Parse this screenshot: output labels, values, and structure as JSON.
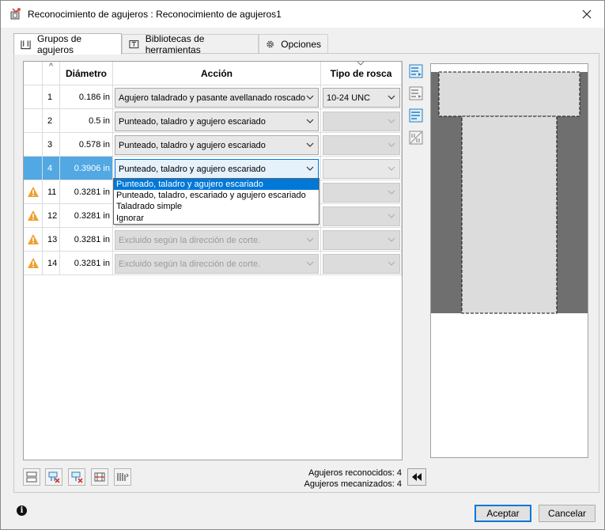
{
  "window": {
    "title": "Reconocimiento de agujeros : Reconocimiento de agujeros1"
  },
  "tabs": [
    {
      "label": "Grupos de agujeros",
      "icon": "hole-groups-icon"
    },
    {
      "label": "Bibliotecas de herramientas",
      "icon": "tool-library-icon"
    },
    {
      "label": "Opciones",
      "icon": "gear-icon"
    }
  ],
  "grid": {
    "headers": {
      "diameter": "Diámetro",
      "action": "Acción",
      "thread": "Tipo de rosca"
    },
    "rows": [
      {
        "num": "1",
        "diameter": "0.186 in",
        "action": "Agujero taladrado y pasante avellanado roscado",
        "thread": "10-24 UNC",
        "warning": false,
        "disabled": false
      },
      {
        "num": "2",
        "diameter": "0.5 in",
        "action": "Punteado, taladro y agujero escariado",
        "thread": "",
        "warning": false,
        "disabled": false
      },
      {
        "num": "3",
        "diameter": "0.578 in",
        "action": "Punteado, taladro y agujero escariado",
        "thread": "",
        "warning": false,
        "disabled": false
      },
      {
        "num": "4",
        "diameter": "0.3906 in",
        "action": "Punteado, taladro y agujero escariado",
        "thread": "",
        "warning": false,
        "disabled": false
      },
      {
        "num": "11",
        "diameter": "0.3281 in",
        "action": "",
        "thread": "",
        "warning": true,
        "disabled": true
      },
      {
        "num": "12",
        "diameter": "0.3281 in",
        "action": "",
        "thread": "",
        "warning": true,
        "disabled": true
      },
      {
        "num": "13",
        "diameter": "0.3281 in",
        "action": "Excluido según la dirección de corte.",
        "thread": "",
        "warning": true,
        "disabled": true
      },
      {
        "num": "14",
        "diameter": "0.3281 in",
        "action": "Excluido según la dirección de corte.",
        "thread": "",
        "warning": true,
        "disabled": true
      }
    ],
    "dropdown_options": [
      "Punteado, taladro y agujero escariado",
      "Punteado, taladro, escariado y agujero escariado",
      "Taladrado simple",
      "Ignorar"
    ]
  },
  "status": {
    "recognized": "Agujeros reconocidos: 4",
    "machined": "Agujeros mecanizados: 4"
  },
  "buttons": {
    "ok": "Aceptar",
    "cancel": "Cancelar"
  },
  "colors": {
    "selection": "#51a8e3",
    "accent": "#0078d7",
    "warning": "#f0a030"
  }
}
